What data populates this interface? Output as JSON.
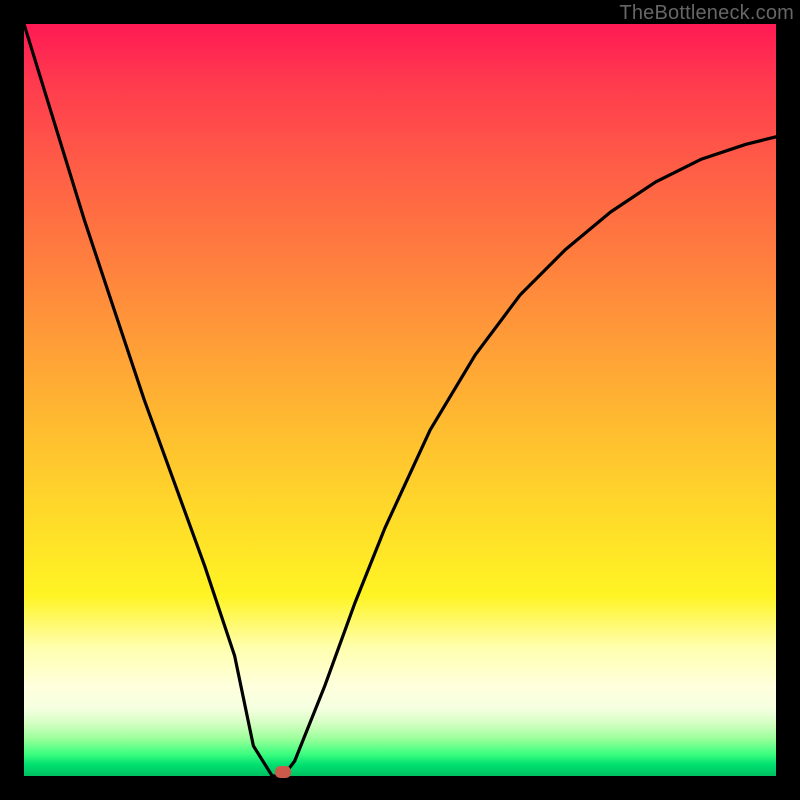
{
  "watermark": "TheBottleneck.com",
  "chart_data": {
    "type": "line",
    "title": "",
    "xlabel": "",
    "ylabel": "",
    "xlim": [
      0,
      1
    ],
    "ylim": [
      0,
      1
    ],
    "series": [
      {
        "name": "curve",
        "x": [
          0.0,
          0.04,
          0.08,
          0.12,
          0.16,
          0.2,
          0.24,
          0.28,
          0.305,
          0.33,
          0.345,
          0.36,
          0.4,
          0.44,
          0.48,
          0.54,
          0.6,
          0.66,
          0.72,
          0.78,
          0.84,
          0.9,
          0.96,
          1.0
        ],
        "y": [
          1.0,
          0.87,
          0.74,
          0.62,
          0.5,
          0.39,
          0.28,
          0.16,
          0.04,
          0.0,
          0.0,
          0.02,
          0.12,
          0.23,
          0.33,
          0.46,
          0.56,
          0.64,
          0.7,
          0.75,
          0.79,
          0.82,
          0.84,
          0.85
        ]
      }
    ],
    "marker": {
      "x": 0.345,
      "y": 0.0
    },
    "background_gradient": {
      "top": "#ff1a54",
      "mid": "#ffdc29",
      "bottom": "#00c060"
    }
  }
}
